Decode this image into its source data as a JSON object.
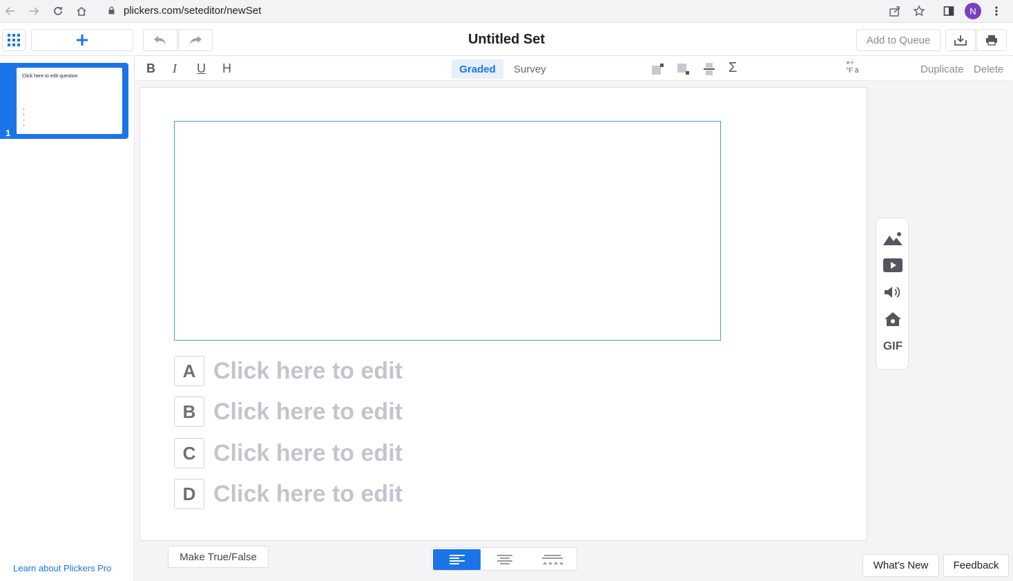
{
  "browser": {
    "url": "plickers.com/seteditor/newSet",
    "profile_initial": "N",
    "profile_color": "#7b3fbf"
  },
  "topbar": {
    "title": "Untitled Set",
    "add_to_queue": "Add to Queue",
    "add_icon": "plus-icon"
  },
  "sidebar": {
    "slides": [
      {
        "number": "1",
        "preview_text": "Click here to edit question",
        "preview_choices": [
          "A",
          "B",
          "C",
          "D"
        ]
      }
    ],
    "learn_link": "Learn about Plickers Pro"
  },
  "format_bar": {
    "bold": "B",
    "italic": "I",
    "underline": "U",
    "highlight": "H",
    "graded": "Graded",
    "survey": "Survey",
    "duplicate": "Duplicate",
    "delete": "Delete",
    "sigma": "Σ",
    "symbols_top": "×÷",
    "symbols_bottom": "°F ä"
  },
  "slide": {
    "choices": [
      {
        "letter": "A",
        "placeholder": "Click here to edit"
      },
      {
        "letter": "B",
        "placeholder": "Click here to edit"
      },
      {
        "letter": "C",
        "placeholder": "Click here to edit"
      },
      {
        "letter": "D",
        "placeholder": "Click here to edit"
      }
    ],
    "media_buttons": [
      "image-icon",
      "video-icon",
      "sound-icon",
      "animation-icon",
      "gif-icon"
    ],
    "gif_label": "GIF"
  },
  "bottom": {
    "make_true_false": "Make True/False",
    "whats_new": "What's New",
    "feedback": "Feedback",
    "alignment_options": [
      "left-align-icon",
      "center-align-icon",
      "spread-align-icon"
    ],
    "active_alignment": "left-align-icon"
  },
  "colors": {
    "accent": "#1a74e8",
    "question_border": "#4a9ad4",
    "placeholder_text": "#c4c4cf"
  }
}
